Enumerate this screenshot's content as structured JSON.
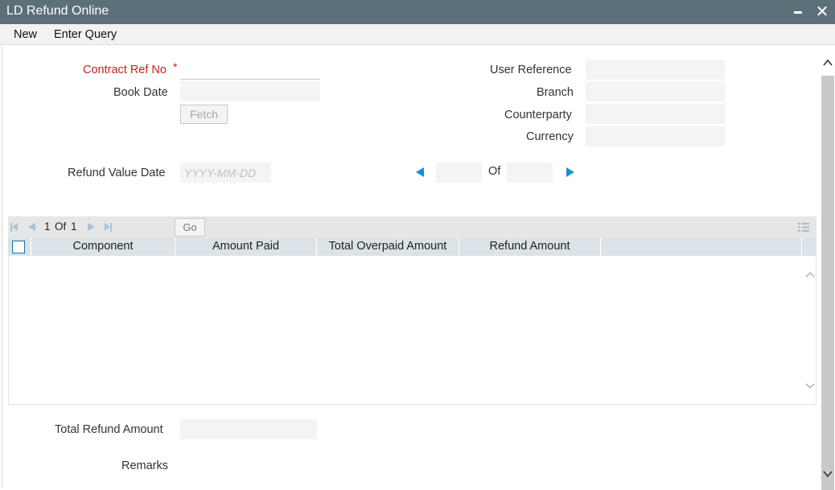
{
  "window": {
    "title": "LD Refund Online"
  },
  "menu": {
    "new": "New",
    "enter_query": "Enter Query"
  },
  "form": {
    "contract_ref_label": "Contract Ref No",
    "required_marker": "*",
    "book_date_label": "Book Date",
    "fetch_label": "Fetch",
    "user_reference_label": "User Reference",
    "branch_label": "Branch",
    "counterparty_label": "Counterparty",
    "currency_label": "Currency",
    "refund_value_date_label": "Refund Value Date",
    "refund_value_date_placeholder": "YYYY-MM-DD",
    "of_label": "Of",
    "contract_ref_value": "",
    "book_date_value": "",
    "user_reference_value": "",
    "branch_value": "",
    "counterparty_value": "",
    "currency_value": ""
  },
  "grid": {
    "page_current": "1",
    "page_of": "Of",
    "page_total": "1",
    "go_label": "Go",
    "columns": [
      "Component",
      "Amount Paid",
      "Total Overpaid Amount",
      "Refund Amount"
    ],
    "rows": []
  },
  "footer": {
    "total_refund_label": "Total Refund Amount",
    "remarks_label": "Remarks"
  },
  "colors": {
    "titlebar": "#5b7079",
    "accent_blue": "#1a8fd6",
    "required_red": "#cc1f1f",
    "grid_header": "#dbe3e8"
  },
  "icons": [
    "minimize-icon",
    "close-icon",
    "previous-icon",
    "next-icon",
    "first-page-icon",
    "prev-page-icon",
    "next-page-icon",
    "last-page-icon",
    "column-settings-icon",
    "scroll-up-icon",
    "scroll-down-icon"
  ]
}
